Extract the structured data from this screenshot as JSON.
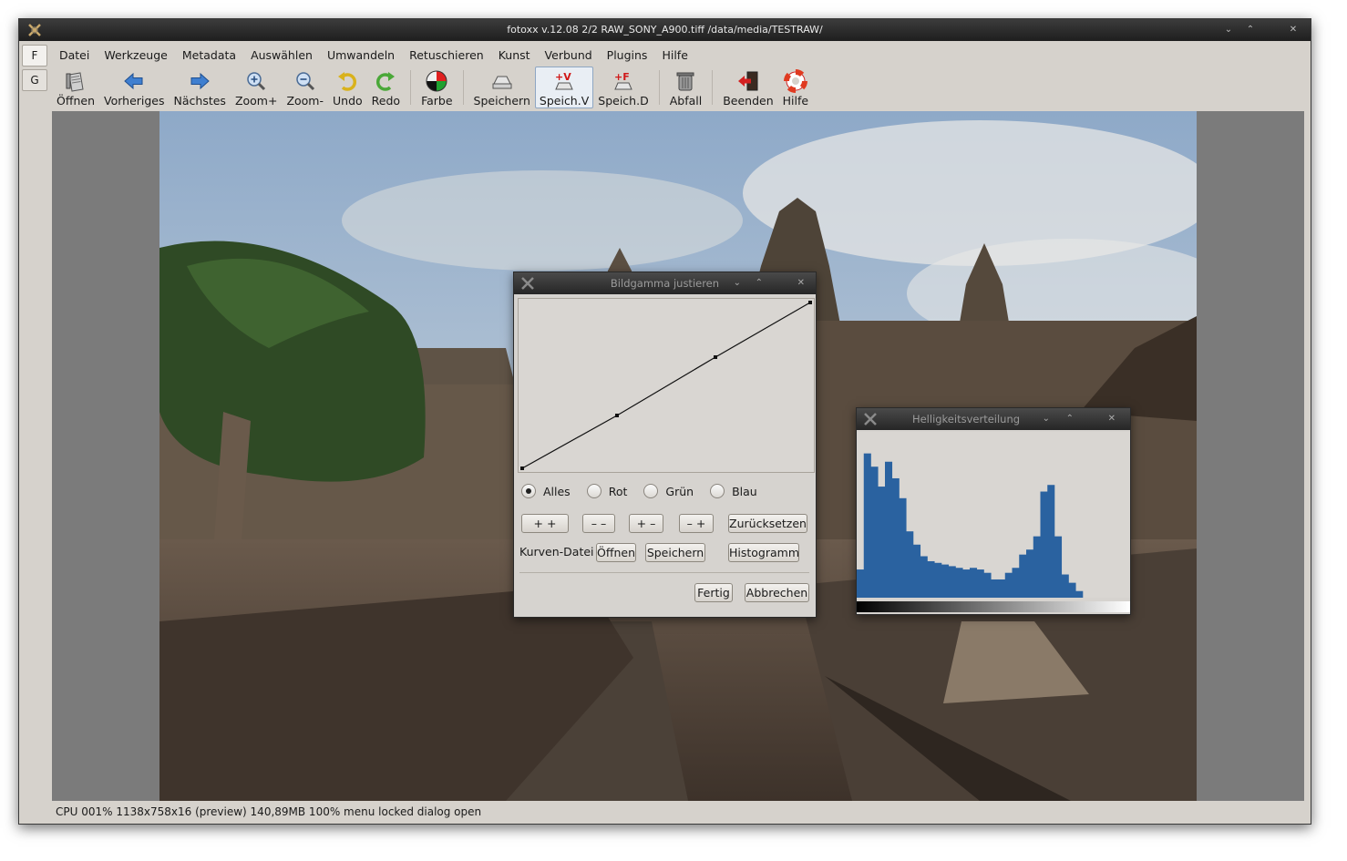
{
  "window": {
    "title": "fotoxx v.12.08   2/2  RAW_SONY_A900.tiff  /data/media/TESTRAW/",
    "controls": {
      "minimize": "⌄",
      "maximize": "⌃",
      "close": "✕"
    }
  },
  "side_tabs": [
    "F",
    "G"
  ],
  "menu": [
    "Datei",
    "Werkzeuge",
    "Metadata",
    "Auswählen",
    "Umwandeln",
    "Retuschieren",
    "Kunst",
    "Verbund",
    "Plugins",
    "Hilfe"
  ],
  "toolbar": [
    {
      "label": "Öffnen",
      "icon": "open-icon"
    },
    {
      "label": "Vorheriges",
      "icon": "arrow-left-icon"
    },
    {
      "label": "Nächstes",
      "icon": "arrow-right-icon"
    },
    {
      "label": "Zoom+",
      "icon": "zoom-in-icon"
    },
    {
      "label": "Zoom-",
      "icon": "zoom-out-icon"
    },
    {
      "label": "Undo",
      "icon": "undo-icon"
    },
    {
      "label": "Redo",
      "icon": "redo-icon"
    },
    {
      "label": "Farbe",
      "icon": "color-wheel-icon"
    },
    {
      "label": "Speichern",
      "icon": "save-icon"
    },
    {
      "label": "Speich.V",
      "icon": "save-version-icon"
    },
    {
      "label": "Speich.D",
      "icon": "save-file-icon"
    },
    {
      "label": "Abfall",
      "icon": "trash-icon"
    },
    {
      "label": "Beenden",
      "icon": "exit-icon"
    },
    {
      "label": "Hilfe",
      "icon": "help-lifebuoy-icon"
    }
  ],
  "status": "CPU 001%  1138x758x16 (preview) 140,89MB 100%  menu locked  dialog open",
  "gamma_dialog": {
    "title": "Bildgamma justieren",
    "radios": [
      {
        "label": "Alles",
        "checked": true
      },
      {
        "label": "Rot",
        "checked": false
      },
      {
        "label": "Grün",
        "checked": false
      },
      {
        "label": "Blau",
        "checked": false
      }
    ],
    "adjust_buttons": [
      "+ +",
      "– –",
      "+ –",
      "– +"
    ],
    "reset_label": "Zurücksetzen",
    "curve_file_label": "Kurven-Datei",
    "open_label": "Öffnen",
    "save_label": "Speichern",
    "histogram_label": "Histogramm",
    "done_label": "Fertig",
    "cancel_label": "Abbrechen"
  },
  "histogram_dialog": {
    "title": "Helligkeitsverteilung",
    "bar_color": "#2a62a0",
    "levels": [
      0.17,
      0.87,
      0.79,
      0.67,
      0.82,
      0.72,
      0.6,
      0.4,
      0.32,
      0.25,
      0.22,
      0.21,
      0.2,
      0.19,
      0.18,
      0.17,
      0.18,
      0.17,
      0.15,
      0.11,
      0.11,
      0.15,
      0.18,
      0.26,
      0.29,
      0.37,
      0.64,
      0.68,
      0.37,
      0.14,
      0.09,
      0.04
    ]
  }
}
